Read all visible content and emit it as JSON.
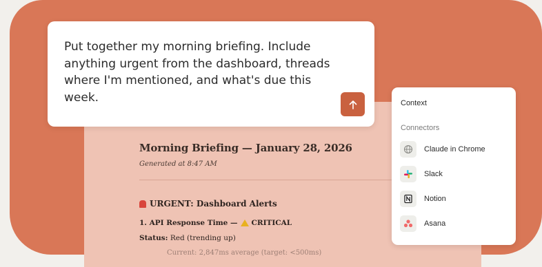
{
  "prompt": {
    "text": "Put together my morning briefing. Include anything urgent from the dashboard, threads where I'm mentioned, and what's due this week.",
    "send_icon": "arrow-up-icon"
  },
  "briefing": {
    "title": "Morning Briefing — January 28, 2026",
    "generated": "Generated at 8:47 AM",
    "urgent_heading": "URGENT: Dashboard Alerts",
    "item_1": "1. API Response Time —",
    "item_1_severity": "CRITICAL",
    "status_label": "Status:",
    "status_value": " Red (trending up)",
    "faded_line": "Current: 2,847ms average (target: <500ms)"
  },
  "context_panel": {
    "title": "Context",
    "section": "Connectors",
    "connectors": [
      {
        "label": "Claude in Chrome",
        "icon": "globe-icon"
      },
      {
        "label": "Slack",
        "icon": "slack-icon"
      },
      {
        "label": "Notion",
        "icon": "notion-icon"
      },
      {
        "label": "Asana",
        "icon": "asana-icon"
      }
    ]
  },
  "colors": {
    "frame": "#d97757",
    "document": "#efc3b4",
    "send_button": "#c9613f"
  }
}
